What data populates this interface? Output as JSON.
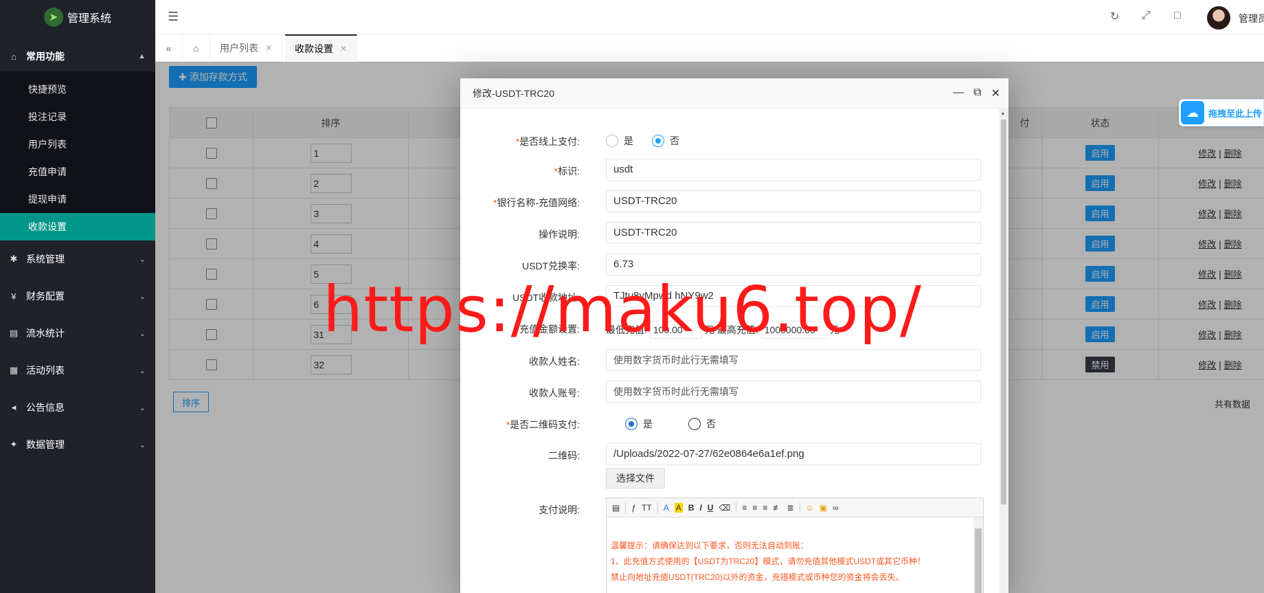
{
  "app": {
    "logo_text": "管理系统"
  },
  "sidebar": {
    "groups": [
      {
        "label": "常用功能",
        "icon": "home-icon",
        "open": true
      },
      {
        "label": "系统管理",
        "icon": "gear-icon"
      },
      {
        "label": "财务配置",
        "icon": "yen-icon"
      },
      {
        "label": "流水统计",
        "icon": "list-icon"
      },
      {
        "label": "活动列表",
        "icon": "gift-icon"
      },
      {
        "label": "公告信息",
        "icon": "speaker-icon"
      },
      {
        "label": "数据管理",
        "icon": "data-icon"
      }
    ],
    "sub_items": [
      "快捷预览",
      "投注记录",
      "用户列表",
      "充值申请",
      "提现申请",
      "收款设置"
    ],
    "active_sub": "收款设置"
  },
  "header": {
    "username": "管理员"
  },
  "tabs": [
    {
      "label": "用户列表"
    },
    {
      "label": "收款设置",
      "active": true
    }
  ],
  "page": {
    "add_button": "添加存款方式",
    "columns": [
      "",
      "排序",
      "",
      "付",
      "状态",
      ""
    ],
    "rows": [
      {
        "sort": "1",
        "status": "启用"
      },
      {
        "sort": "2",
        "status": "启用"
      },
      {
        "sort": "3",
        "status": "启用"
      },
      {
        "sort": "4",
        "status": "启用"
      },
      {
        "sort": "5",
        "status": "启用"
      },
      {
        "sort": "6",
        "status": "启用"
      },
      {
        "sort": "31",
        "status": "启用"
      },
      {
        "sort": "32",
        "status": "禁用"
      }
    ],
    "edit_label": "修改",
    "delete_label": "删除",
    "sort_button": "排序",
    "total_text": "共有数据"
  },
  "upload_float": {
    "label": "拖拽至此上传"
  },
  "modal": {
    "title": "修改-USDT-TRC20",
    "online_pay": {
      "label": "是否线上支付:",
      "yes": "是",
      "no": "否",
      "selected": "否"
    },
    "identifier": {
      "label": "标识:",
      "value": "usdt"
    },
    "bank_name": {
      "label": "银行名称-充值网络:",
      "value": "USDT-TRC20"
    },
    "op_desc": {
      "label": "操作说明:",
      "value": "USDT-TRC20"
    },
    "rate": {
      "label": "USDT兑换率:",
      "value": "6.73"
    },
    "address": {
      "label": "USDT收款地址:",
      "value": "TJtu8yMpwd  hNY9w2"
    },
    "amount": {
      "label": "充值金额设置:",
      "min_label": "最低充值:",
      "min_value": "100.00",
      "unit": "元",
      "max_label": "最高充值:",
      "max_value": "1000000.00",
      "unit2": "元"
    },
    "payee_name": {
      "label": "收款人姓名:",
      "placeholder": "使用数字货币时此行无需填写"
    },
    "payee_account": {
      "label": "收款人账号:",
      "placeholder": "使用数字货币时此行无需填写"
    },
    "qr_pay": {
      "label": "是否二维码支付:",
      "yes": "是",
      "no": "否",
      "selected": "是"
    },
    "qrcode": {
      "label": "二维码:",
      "value": "/Uploads/2022-07-27/62e0864e6a1ef.png",
      "choose": "选择文件"
    },
    "pay_desc": {
      "label": "支付说明:",
      "lines": [
        "温馨提示：请确保达到以下要求，否则无法自动到账：",
        "1、此充值方式使用的【USDT为TRC20】模式，请勿充值其他模式USDT或其它币种！",
        "禁止向地址充值USDT(TRC20)以外的资金，充错模式或币种您的资金将会丢失。"
      ]
    }
  },
  "watermark": "https://maku6.top/",
  "colors": {
    "primary": "#1e9fff",
    "sidebar": "#20222a",
    "active": "#009688",
    "watermark": "#ff1a1a",
    "warning": "#ff5722"
  }
}
